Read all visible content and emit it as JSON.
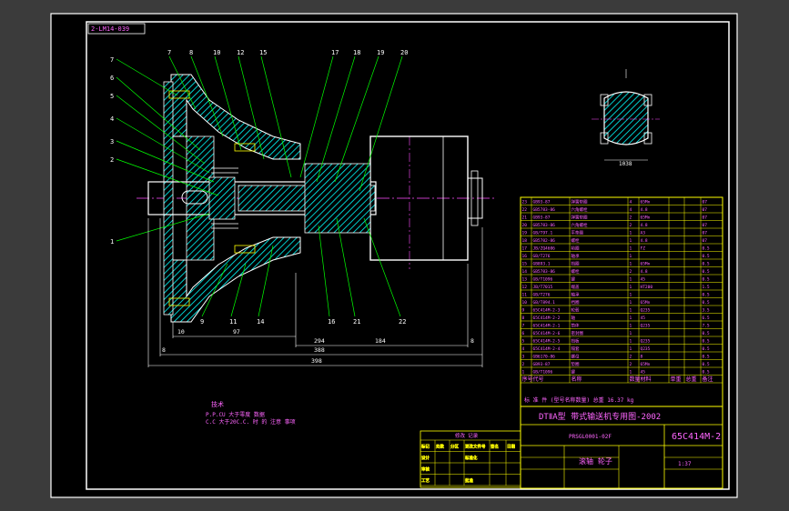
{
  "drawing_code_box": "2-LM14-039",
  "title_block": {
    "project": "DTⅡA型 带式输送机专用图-2002",
    "drawing_no": "65C414M-2",
    "part_name": "滚轴 轮子",
    "designer_code": "PRSGL0001-02F",
    "scale_label": "1:37",
    "sheet_label": "1 37 kg"
  },
  "notes": {
    "heading": "技术",
    "line1": "P.P.CU 大于零度 数据",
    "line2": "C.C 大于20C.C. 时 的 注意 事项"
  },
  "dimensions": {
    "d_97": "97",
    "d_294": "294",
    "d_184": "184",
    "d_388": "388",
    "d_398": "398",
    "d_8a": "8",
    "d_8b": "8",
    "d_10": "10",
    "shaft_cut": "1038"
  },
  "leaders_top": [
    "7",
    "8",
    "10",
    "12",
    "13",
    "15",
    "17",
    "18",
    "19",
    "20"
  ],
  "leaders_left": [
    "7",
    "6",
    "5",
    "4",
    "3",
    "2",
    "1"
  ],
  "leaders_bottom": [
    "9",
    "11",
    "14",
    "16",
    "21",
    "22"
  ],
  "bom_header": [
    "序号",
    "代号",
    "名称",
    "数量",
    "材料",
    "单重",
    "总重",
    "备注"
  ],
  "bom_rows": [
    [
      "23",
      "GB93-87",
      "弹簧垫圈",
      "4",
      "65Mn",
      "",
      "",
      "07"
    ],
    [
      "22",
      "GB5783-86",
      "六角螺栓",
      "4",
      "4.8",
      "",
      "",
      "07"
    ],
    [
      "21",
      "GB93-87",
      "弹簧垫圈",
      "2",
      "65Mn",
      "",
      "",
      "07"
    ],
    [
      "20",
      "GB5783-86",
      "六角螺栓",
      "2",
      "4.8",
      "",
      "",
      "07"
    ],
    [
      "19",
      "GB/T97.1",
      "平垫圈",
      "1",
      "A3",
      "",
      "",
      "07"
    ],
    [
      "18",
      "GB5782-86",
      "螺栓",
      "1",
      "4.8",
      "",
      "",
      "07"
    ],
    [
      "17",
      "JB/ZQ4606",
      "毡圈",
      "1",
      "FZ",
      "",
      "",
      "0.5"
    ],
    [
      "16",
      "GB/T276",
      "轴承",
      "1",
      "",
      "",
      "",
      "0.5"
    ],
    [
      "15",
      "GB893.1",
      "挡圈",
      "1",
      "65Mn",
      "",
      "",
      "0.5"
    ],
    [
      "14",
      "GB5783-86",
      "螺栓",
      "2",
      "4.8",
      "",
      "",
      "0.5"
    ],
    [
      "13",
      "GB/T1096",
      "键",
      "1",
      "45",
      "",
      "",
      "0.5"
    ],
    [
      "12",
      "JB/T7015",
      "端盖",
      "1",
      "HT200",
      "",
      "",
      "1.5"
    ],
    [
      "11",
      "GB/T276",
      "轴承",
      "1",
      "",
      "",
      "",
      "0.5"
    ],
    [
      "10",
      "GB/T894.1",
      "挡圈",
      "1",
      "65Mn",
      "",
      "",
      "0.5"
    ],
    [
      "9",
      "65C414M-2-3",
      "轮毂",
      "1",
      "Q235",
      "",
      "",
      "3.5"
    ],
    [
      "8",
      "65C414M-2-2",
      "轴",
      "1",
      "45",
      "",
      "",
      "6.5"
    ],
    [
      "7",
      "65C414M-2-1",
      "筒体",
      "1",
      "Q235",
      "",
      "",
      "7.5"
    ],
    [
      "6",
      "65C414M-2-6",
      "密封圈",
      "1",
      "",
      "",
      "",
      "0.5"
    ],
    [
      "5",
      "65C414M-2-5",
      "挡板",
      "1",
      "Q235",
      "",
      "",
      "0.5"
    ],
    [
      "4",
      "65C414M-2-4",
      "隔套",
      "1",
      "Q235",
      "",
      "",
      "0.5"
    ],
    [
      "3",
      "GB6170-86",
      "螺母",
      "2",
      "8",
      "",
      "",
      "0.5"
    ],
    [
      "2",
      "GB93-87",
      "垫圈",
      "2",
      "65Mn",
      "",
      "",
      "0.5"
    ],
    [
      "1",
      "GB/T1096",
      "键",
      "1",
      "45",
      "",
      "",
      "0.5"
    ]
  ],
  "bom_footer": "标 准 件 (型号名称数量)  总重  16.37 kg",
  "rev_table": {
    "heading": "修改 记录",
    "rows": [
      [
        "标记",
        "处数",
        "分区",
        "更改文件号",
        "签名",
        "日期"
      ],
      [
        "设计",
        "",
        "",
        "标准化",
        "",
        ""
      ],
      [
        "审核",
        "",
        "",
        "",
        "",
        ""
      ],
      [
        "工艺",
        "",
        "",
        "批准",
        "",
        ""
      ]
    ]
  },
  "colors": {
    "frame": "#ffffff",
    "section": "#00ffff",
    "outline": "#ffffff",
    "leader": "#00ff00",
    "center": "#ff4dff",
    "table": "#ffff00",
    "text": "#ff66ff",
    "background": "#000000",
    "viewport": "#3b3b3b"
  }
}
